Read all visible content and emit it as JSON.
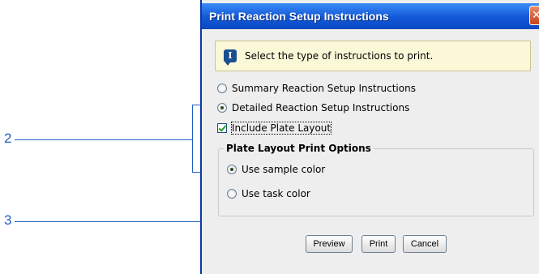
{
  "callouts": {
    "two": "2",
    "three": "3"
  },
  "dialog": {
    "title": "Print Reaction Setup Instructions",
    "close_glyph": "✕",
    "info": {
      "icon": "info-icon",
      "icon_glyph": "I",
      "text": "Select the type of instructions to print."
    },
    "options": {
      "summary": {
        "label": "Summary Reaction Setup Instructions",
        "checked": false
      },
      "detailed": {
        "label": "Detailed Reaction Setup Instructions",
        "checked": true
      },
      "include_plate_layout": {
        "label": "Include Plate Layout",
        "checked": true
      }
    },
    "plate_layout_group": {
      "title": "Plate Layout Print Options",
      "sample_color": {
        "label": "Use sample color",
        "checked": true
      },
      "task_color": {
        "label": "Use task color",
        "checked": false
      }
    },
    "buttons": {
      "preview": "Preview",
      "print": "Print",
      "cancel": "Cancel"
    }
  },
  "colors": {
    "callout": "#1f5fbf",
    "titlebar": "#1257d6",
    "info_bg": "#fbf8d8",
    "dialog_bg": "#eeeeee"
  }
}
